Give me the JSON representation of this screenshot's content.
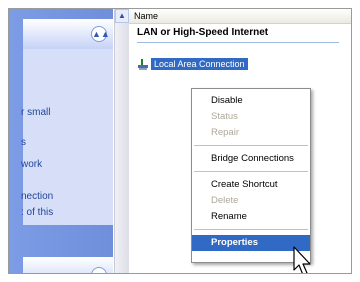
{
  "left_pane": {
    "fragments": [
      "r small",
      "s",
      "work",
      "nection",
      ": of this"
    ]
  },
  "content": {
    "column_header": "Name",
    "group_title": "LAN or High-Speed Internet",
    "selected_item": "Local Area Connection"
  },
  "context_menu": {
    "items": [
      {
        "label": "Disable",
        "enabled": true
      },
      {
        "label": "Status",
        "enabled": false
      },
      {
        "label": "Repair",
        "enabled": false
      },
      {
        "label": "Bridge Connections",
        "enabled": true
      },
      {
        "label": "Create Shortcut",
        "enabled": true
      },
      {
        "label": "Delete",
        "enabled": false
      },
      {
        "label": "Rename",
        "enabled": true
      },
      {
        "label": "Properties",
        "enabled": true,
        "highlighted": true
      }
    ]
  },
  "colors": {
    "selection": "#316ac5",
    "task_pane": "#6f8fdb",
    "disabled_text": "#aca899"
  }
}
